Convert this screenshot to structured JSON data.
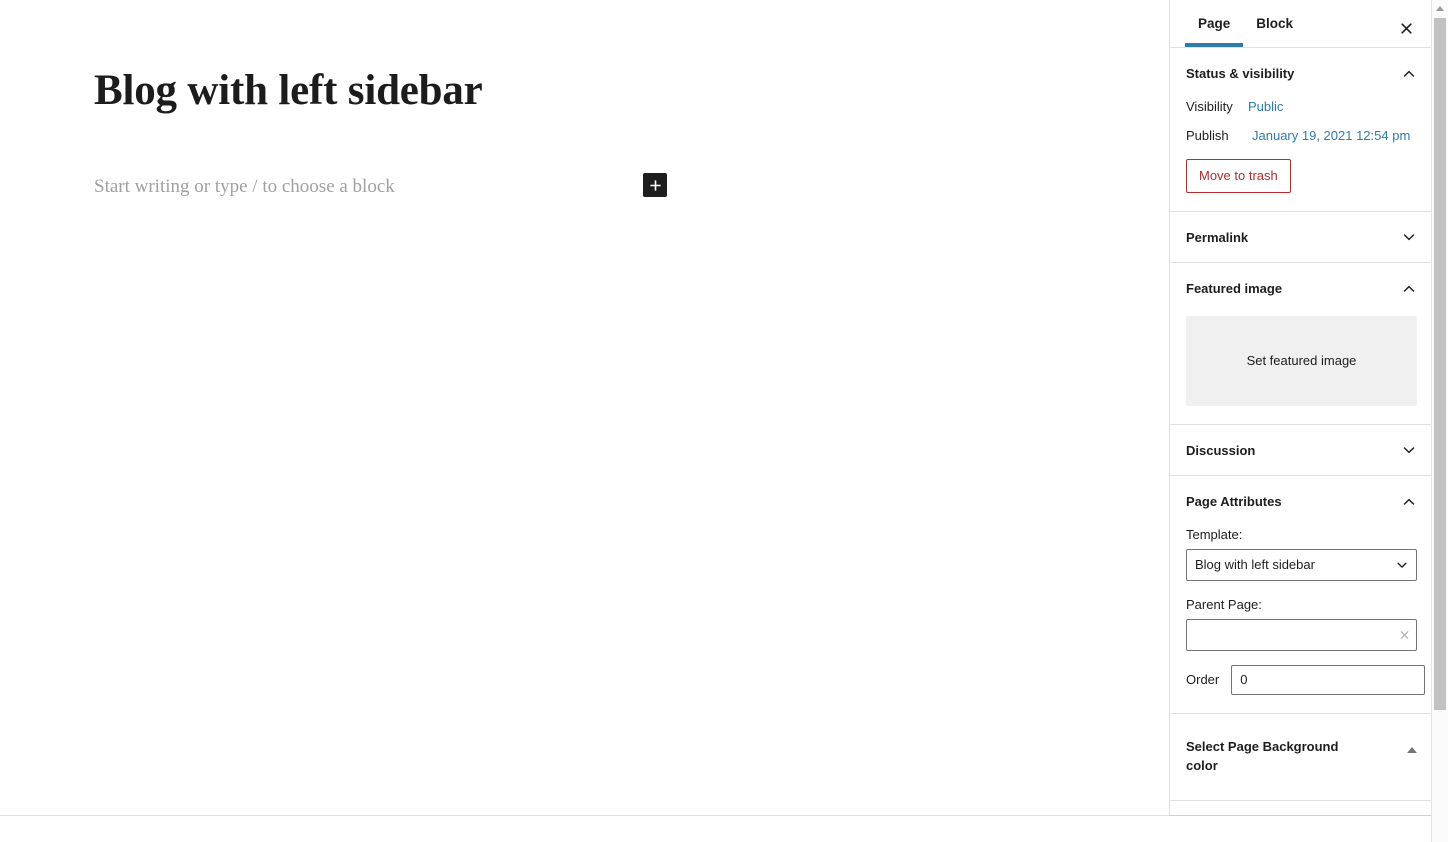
{
  "editor": {
    "post_title": "Blog with left sidebar",
    "block_placeholder": "Start writing or type / to choose a block",
    "inserter_label": "Add block"
  },
  "sidebar": {
    "tabs": [
      {
        "label": "Page",
        "active": true
      },
      {
        "label": "Block",
        "active": false
      }
    ],
    "close_label": "Close settings",
    "panels": {
      "status_visibility": {
        "title": "Status & visibility",
        "expanded": true,
        "visibility_label": "Visibility",
        "visibility_value": "Public",
        "publish_label": "Publish",
        "publish_value": "January 19, 2021 12:54 pm",
        "trash_label": "Move to trash"
      },
      "permalink": {
        "title": "Permalink",
        "expanded": false
      },
      "featured_image": {
        "title": "Featured image",
        "expanded": true,
        "set_label": "Set featured image"
      },
      "discussion": {
        "title": "Discussion",
        "expanded": false
      },
      "page_attributes": {
        "title": "Page Attributes",
        "expanded": true,
        "template_label": "Template:",
        "template_value": "Blog with left sidebar",
        "parent_label": "Parent Page:",
        "parent_value": "",
        "parent_placeholder": "",
        "order_label": "Order",
        "order_value": "0"
      },
      "background_color": {
        "title": "Select Page Background color",
        "expanded": true
      }
    }
  },
  "colors": {
    "accent_blue": "#2f7cab",
    "link_blue": "#2f7cab",
    "danger_red": "#b32d2e",
    "text_dark": "#1e1e1e",
    "placeholder_gray": "#a0a0a0",
    "panel_border": "#e0e0e0",
    "featured_bg": "#f0f0f0",
    "inserter_bg": "#1e1e1e",
    "scrollbar_thumb": "#c1c1c1"
  },
  "scrollbar": {
    "up_arrow": "scroll-up"
  }
}
